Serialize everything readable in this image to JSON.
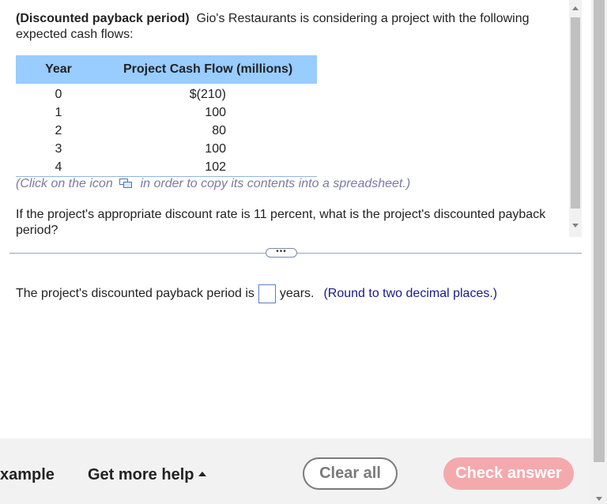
{
  "problem": {
    "title": "(Discounted payback period)",
    "intro": "Gio's Restaurants is considering a project with the following expected cash flows:",
    "table": {
      "headers": [
        "Year",
        "Project Cash Flow (millions)"
      ],
      "rows": [
        {
          "year": "0",
          "flow": "$(210)"
        },
        {
          "year": "1",
          "flow": "100"
        },
        {
          "year": "2",
          "flow": "80"
        },
        {
          "year": "3",
          "flow": "100"
        },
        {
          "year": "4",
          "flow": "102"
        }
      ]
    },
    "click_note_before": "(Click on the icon",
    "click_note_after": "in order to copy its contents into a spreadsheet.)",
    "question": "If the project's appropriate discount rate is 11 percent, what is the project's discounted payback period?"
  },
  "expand_button": "•••",
  "answer": {
    "prefix": "The project's discounted payback period is",
    "value": "",
    "suffix": "years.",
    "hint": "(Round to two decimal places.)"
  },
  "footer": {
    "example": "xample",
    "help": "Get more help",
    "clear": "Clear all",
    "check": "Check answer"
  },
  "icons": {
    "copy": "copy-to-spreadsheet-icon",
    "help_caret": "caret-up-icon"
  },
  "colors": {
    "table_header": "#99ccff",
    "hint": "#1a1a8c",
    "check_button": "#f4a9ad",
    "note": "#7a7aa8"
  }
}
